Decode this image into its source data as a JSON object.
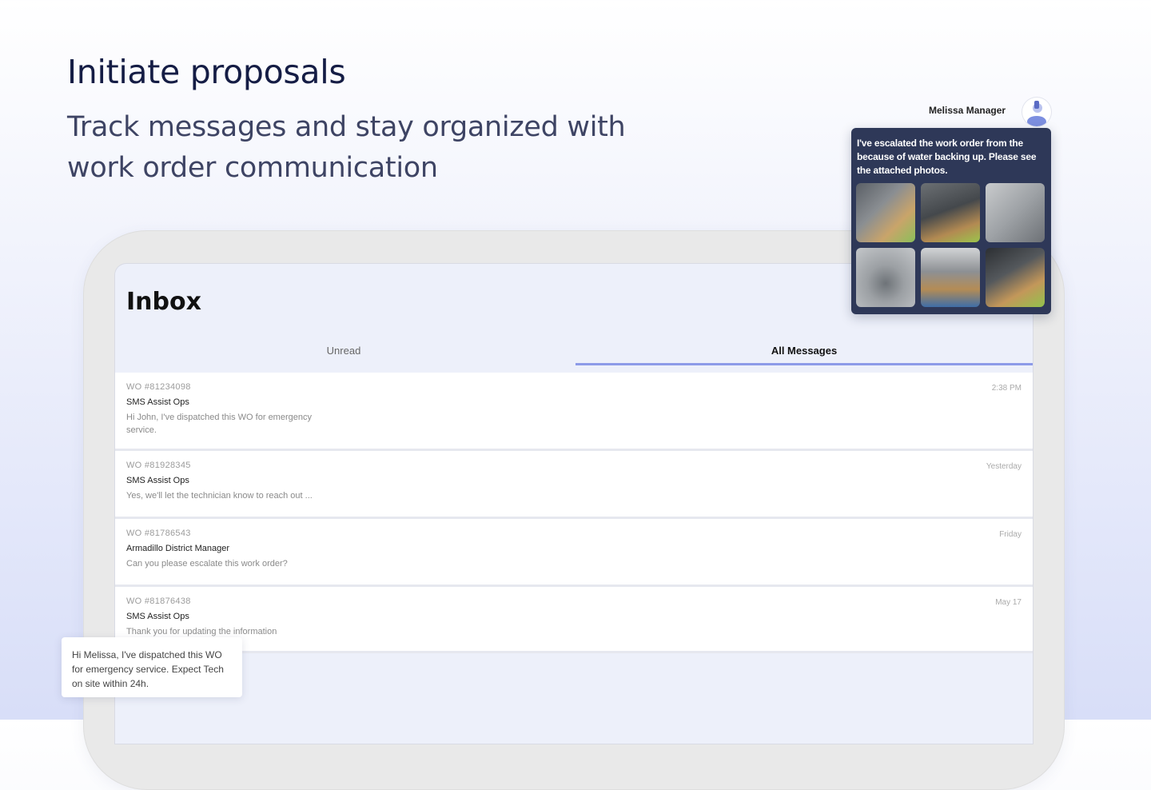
{
  "hero": {
    "title": "Initiate proposals",
    "subtitle": "Track messages and stay organized with work order communication"
  },
  "inbox": {
    "title": "Inbox",
    "tabs": [
      {
        "label": "Unread",
        "selected": false
      },
      {
        "label": "All Messages",
        "selected": true
      }
    ],
    "messages": [
      {
        "wo": "WO #81234098",
        "sender": "SMS Assist Ops",
        "preview": "Hi John, I've dispatched this WO for emergency service.",
        "time": "2:38 PM"
      },
      {
        "wo": "WO #81928345",
        "sender": "SMS Assist Ops",
        "preview": "Yes, we'll let the technician know to reach out ...",
        "time": "Yesterday"
      },
      {
        "wo": "WO #81786543",
        "sender": "Armadillo District Manager",
        "preview": "Can you please escalate this work order?",
        "time": "Friday"
      },
      {
        "wo": "WO #81876438",
        "sender": "SMS Assist Ops",
        "preview": "Thank you for updating the information",
        "time": "May 17"
      }
    ]
  },
  "chat": {
    "name": "Melissa Manager",
    "message": "I've escalated the work order from the because of water backing up. Please see the attached photos.",
    "avatar_icon": "person-avatar-icon",
    "photo_count": 6
  },
  "reply": {
    "message": "Hi Melissa, I've dispatched this WO for emergency service. Expect Tech on site within 24h."
  },
  "colors": {
    "heading": "#151d45",
    "accent": "#8d9be8",
    "chat_bg": "#2e3858"
  }
}
